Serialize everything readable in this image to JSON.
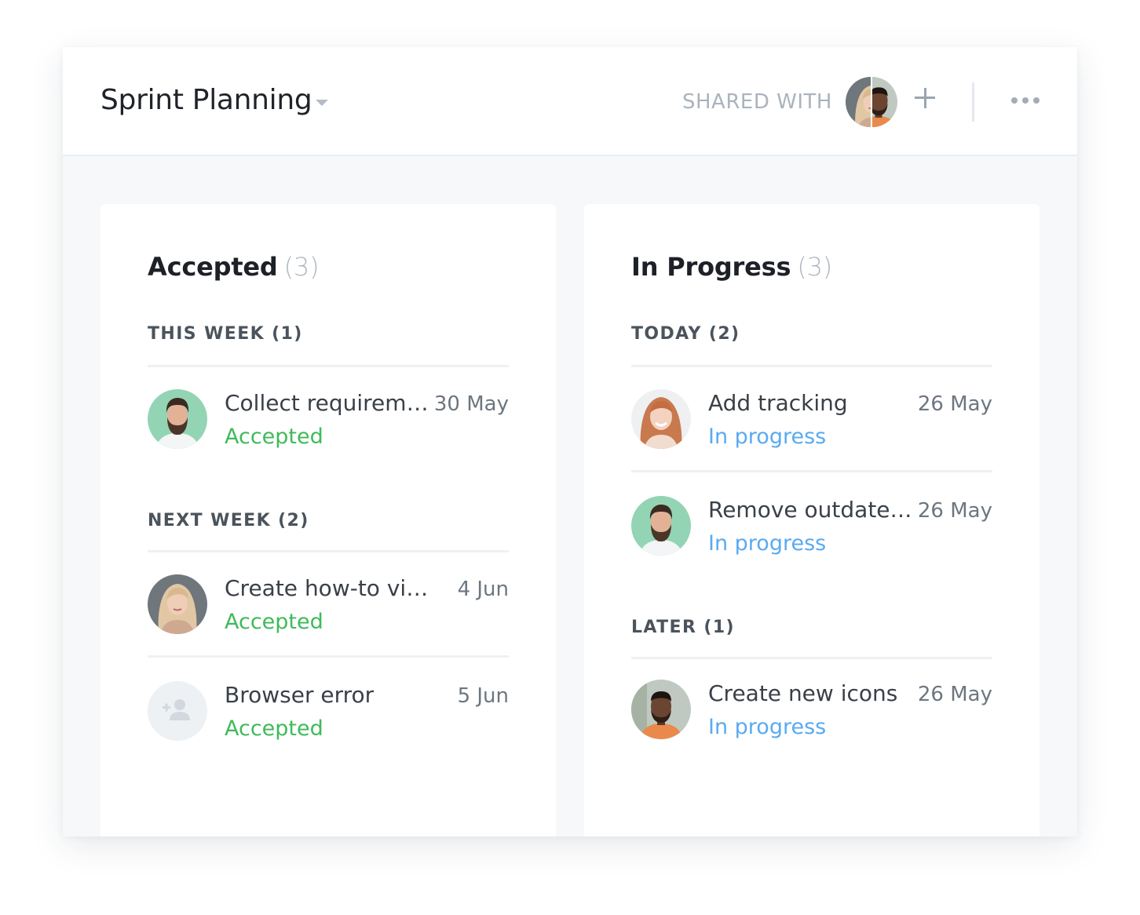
{
  "header": {
    "title": "Sprint Planning",
    "shared_label": "SHARED WITH"
  },
  "colors": {
    "accepted": "#3fba5a",
    "in_progress": "#5aaaf0",
    "muted": "#aab3bd"
  },
  "columns": [
    {
      "title": "Accepted",
      "count": "(3)",
      "groups": [
        {
          "label": "THIS WEEK (1)",
          "tasks": [
            {
              "name": "Collect requireme...",
              "date": "30 May",
              "status": "Accepted",
              "avatar": "man-beard-green"
            }
          ]
        },
        {
          "label": "NEXT WEEK (2)",
          "tasks": [
            {
              "name": "Create how-to video",
              "date": "4 Jun",
              "status": "Accepted",
              "avatar": "woman-blonde"
            },
            {
              "name": "Browser error",
              "date": "5 Jun",
              "status": "Accepted",
              "avatar": "unassigned"
            }
          ]
        }
      ]
    },
    {
      "title": "In Progress",
      "count": "(3)",
      "groups": [
        {
          "label": "TODAY (2)",
          "tasks": [
            {
              "name": "Add tracking",
              "date": "26 May",
              "status": "In progress",
              "avatar": "woman-redhead"
            },
            {
              "name": "Remove outdated...",
              "date": "26 May",
              "status": "In progress",
              "avatar": "man-beard-green"
            }
          ]
        },
        {
          "label": "LATER (1)",
          "tasks": [
            {
              "name": "Create new icons",
              "date": "26 May",
              "status": "In progress",
              "avatar": "man-dark"
            }
          ]
        }
      ]
    }
  ]
}
